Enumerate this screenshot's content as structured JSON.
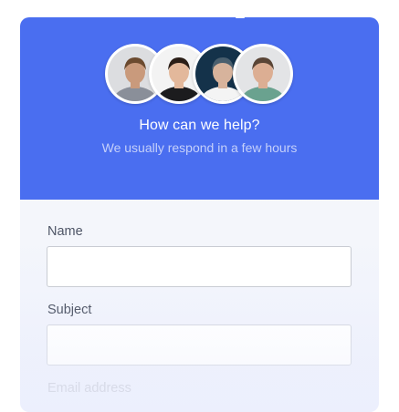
{
  "header": {
    "title": "How can we help?",
    "subtitle": "We usually respond in a few hours",
    "background_color": "#4a6ef0"
  },
  "avatars": [
    {
      "name": "team-avatar-1",
      "hair": "#6b4a2f",
      "skin": "#c99a7c",
      "shirt": "#8a8f99",
      "bg": "#dcdde0"
    },
    {
      "name": "team-avatar-2",
      "hair": "#2b1e17",
      "skin": "#e3b89b",
      "shirt": "#1c1c1e",
      "bg": "#f3f3f3"
    },
    {
      "name": "team-avatar-3",
      "hair": "#4a5f6e",
      "skin": "#d7b39c",
      "shirt": "#f4f4f4",
      "bg": "#14324a"
    },
    {
      "name": "team-avatar-4",
      "hair": "#5a4536",
      "skin": "#dcae93",
      "shirt": "#6aa28f",
      "bg": "#e3e4e6"
    }
  ],
  "form": {
    "name_label": "Name",
    "name_value": "",
    "subject_label": "Subject",
    "subject_value": "",
    "email_label": "Email address"
  }
}
